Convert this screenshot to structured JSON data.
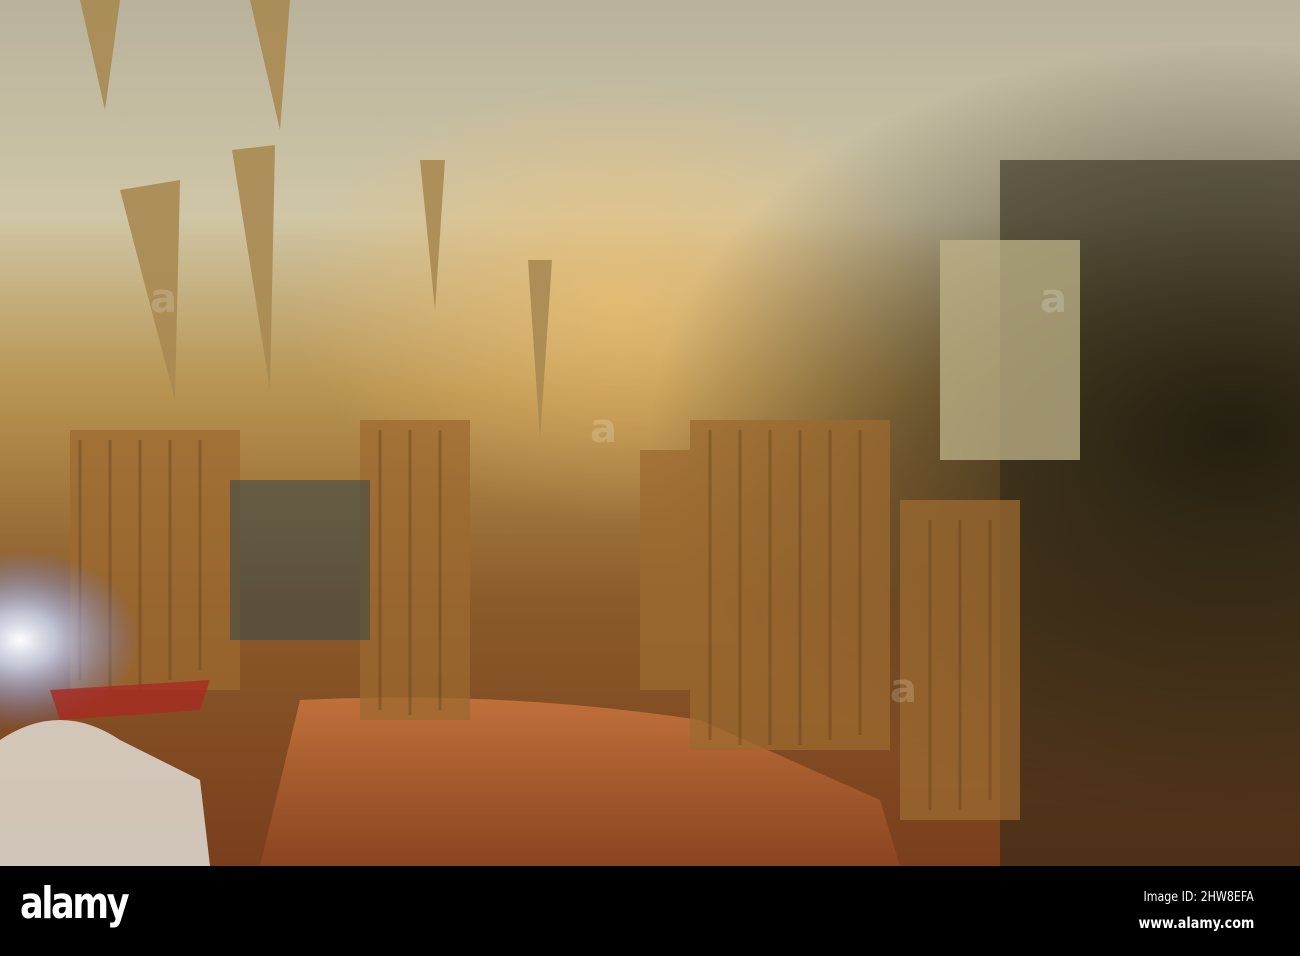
{
  "photo": {
    "subject": "cave-stalactites",
    "colors": {
      "ceiling": "#c9c1a8",
      "gold": "#c99a4a",
      "dark": "#1e1a10",
      "floor": "#b5652c",
      "light": "#e8f0ff"
    }
  },
  "watermark": {
    "text": "alamy"
  },
  "footer": {
    "logo": "alamy",
    "image_id": "Image ID: 2HW8EFA",
    "url": "www.alamy.com"
  }
}
